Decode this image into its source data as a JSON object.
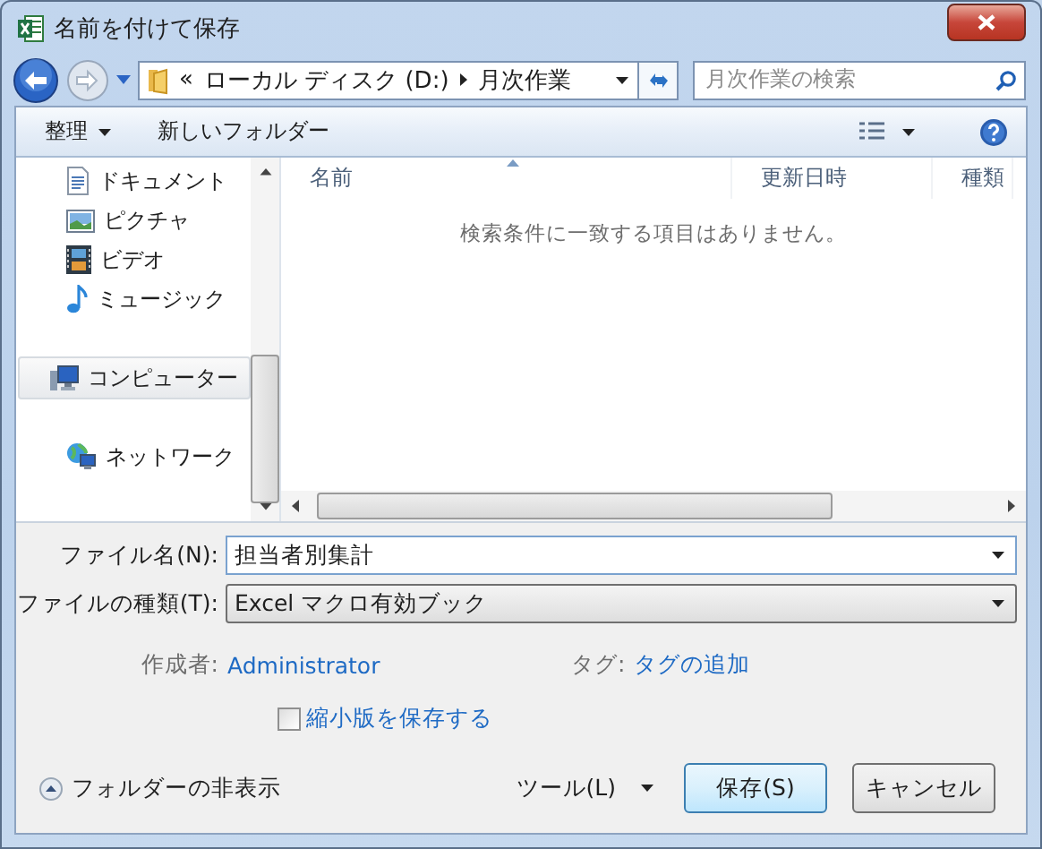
{
  "window": {
    "title": "名前を付けて保存"
  },
  "address": {
    "overflow": "«",
    "path": [
      "ローカル ディスク (D:)",
      "月次作業"
    ]
  },
  "search": {
    "placeholder": "月次作業の検索"
  },
  "toolbar": {
    "organize": "整理",
    "new_folder": "新しいフォルダー"
  },
  "nav_groups": [
    [
      {
        "label": "ドキュメント",
        "kind": "documents",
        "selected": false
      },
      {
        "label": "ピクチャ",
        "kind": "pictures",
        "selected": false
      },
      {
        "label": "ビデオ",
        "kind": "videos",
        "selected": false
      },
      {
        "label": "ミュージック",
        "kind": "music",
        "selected": false
      }
    ],
    [
      {
        "label": "コンピューター",
        "kind": "computer",
        "selected": true
      }
    ],
    [
      {
        "label": "ネットワーク",
        "kind": "network",
        "selected": false
      }
    ]
  ],
  "columns": [
    {
      "label": "名前",
      "sorted": true
    },
    {
      "label": "更新日時",
      "sorted": false
    },
    {
      "label": "種類",
      "sorted": false
    }
  ],
  "empty_message": "検索条件に一致する項目はありません。",
  "form": {
    "filename_label": "ファイル名(N):",
    "filename": "担当者別集計",
    "type_label": "ファイルの種類(T):",
    "type": "Excel マクロ有効ブック",
    "author_label": "作成者:",
    "author": "Administrator",
    "tags_label": "タグ:",
    "tags": "タグの追加",
    "thumbnail": {
      "label": "縮小版を保存する",
      "checked": false
    }
  },
  "footer": {
    "hide_folders": "フォルダーの非表示",
    "tools": "ツール(L)",
    "save": "保存(S)",
    "cancel": "キャンセル"
  }
}
